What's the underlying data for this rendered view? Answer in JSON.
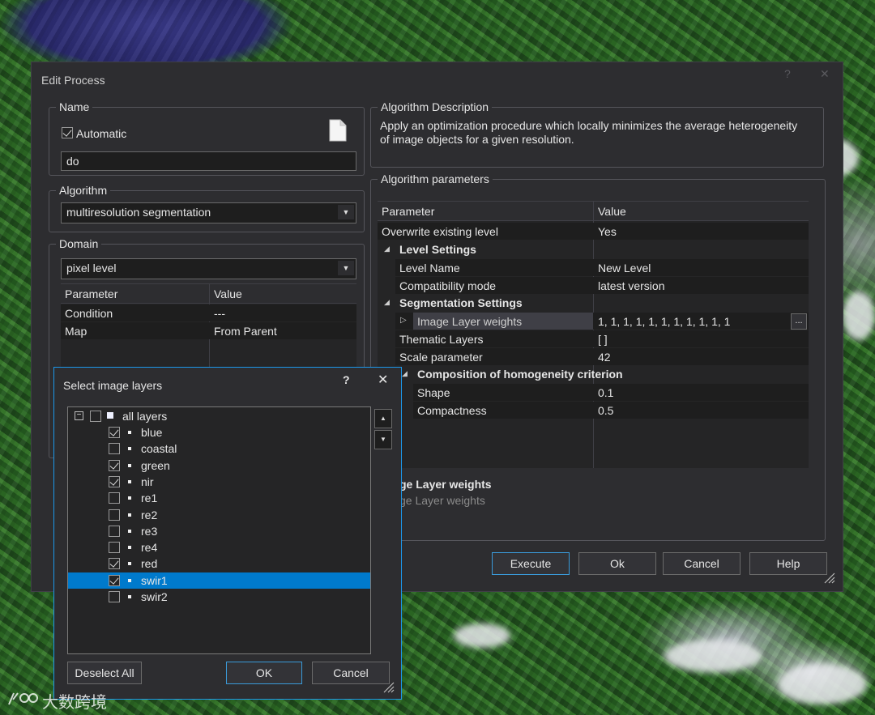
{
  "dialog": {
    "title": "Edit Process",
    "help_glyph": "?",
    "close_glyph": "✕"
  },
  "name_group": {
    "label": "Name",
    "automatic_label": "Automatic",
    "automatic_checked": true,
    "value": "do"
  },
  "algorithm_group": {
    "label": "Algorithm",
    "selected": "multiresolution segmentation"
  },
  "domain_group": {
    "label": "Domain",
    "selected": "pixel level",
    "columns": [
      "Parameter",
      "Value"
    ],
    "rows": [
      {
        "parameter": "Condition",
        "value": "---"
      },
      {
        "parameter": "Map",
        "value": "From Parent"
      }
    ]
  },
  "description_group": {
    "label": "Algorithm Description",
    "text": "Apply an optimization procedure which locally minimizes the average heterogeneity of image objects for a given resolution."
  },
  "params_group": {
    "label": "Algorithm parameters",
    "columns": [
      "Parameter",
      "Value"
    ],
    "overwrite": {
      "parameter": "Overwrite existing level",
      "value": "Yes"
    },
    "level_settings": "Level Settings",
    "level_name": {
      "parameter": "Level Name",
      "value": "New Level"
    },
    "compat": {
      "parameter": "Compatibility mode",
      "value": "latest version"
    },
    "segmentation_settings": "Segmentation Settings",
    "layer_weights": {
      "parameter": "Image Layer weights",
      "value": "1, 1, 1, 1, 1, 1, 1, 1, 1, 1, 1",
      "browse": "..."
    },
    "thematic": {
      "parameter": "Thematic Layers",
      "value": "[ ]"
    },
    "scale": {
      "parameter": "Scale parameter",
      "value": "42"
    },
    "composition": "Composition of homogeneity criterion",
    "shape": {
      "parameter": "Shape",
      "value": "0.1"
    },
    "compactness": {
      "parameter": "Compactness",
      "value": "0.5"
    },
    "help_title": "ge Layer weights",
    "help_text": "ge Layer weights"
  },
  "buttons": {
    "execute": "Execute",
    "ok": "Ok",
    "cancel": "Cancel",
    "help": "Help"
  },
  "select_layers": {
    "title": "Select image layers",
    "help_glyph": "?",
    "close_glyph": "✕",
    "root_toggle": "−",
    "root_label": "all layers",
    "layers": [
      {
        "name": "blue",
        "checked": true
      },
      {
        "name": "coastal",
        "checked": false
      },
      {
        "name": "green",
        "checked": true
      },
      {
        "name": "nir",
        "checked": true
      },
      {
        "name": "re1",
        "checked": false
      },
      {
        "name": "re2",
        "checked": false
      },
      {
        "name": "re3",
        "checked": false
      },
      {
        "name": "re4",
        "checked": false
      },
      {
        "name": "red",
        "checked": true
      },
      {
        "name": "swir1",
        "checked": true
      },
      {
        "name": "swir2",
        "checked": false
      }
    ],
    "selected_layer": "swir1",
    "deselect_all": "Deselect All",
    "ok": "OK",
    "cancel": "Cancel"
  },
  "watermark": {
    "text": "大数跨境"
  },
  "colors": {
    "accent": "#007acc",
    "dialog_bg": "#2d2d30",
    "grid_bg": "#252526"
  }
}
